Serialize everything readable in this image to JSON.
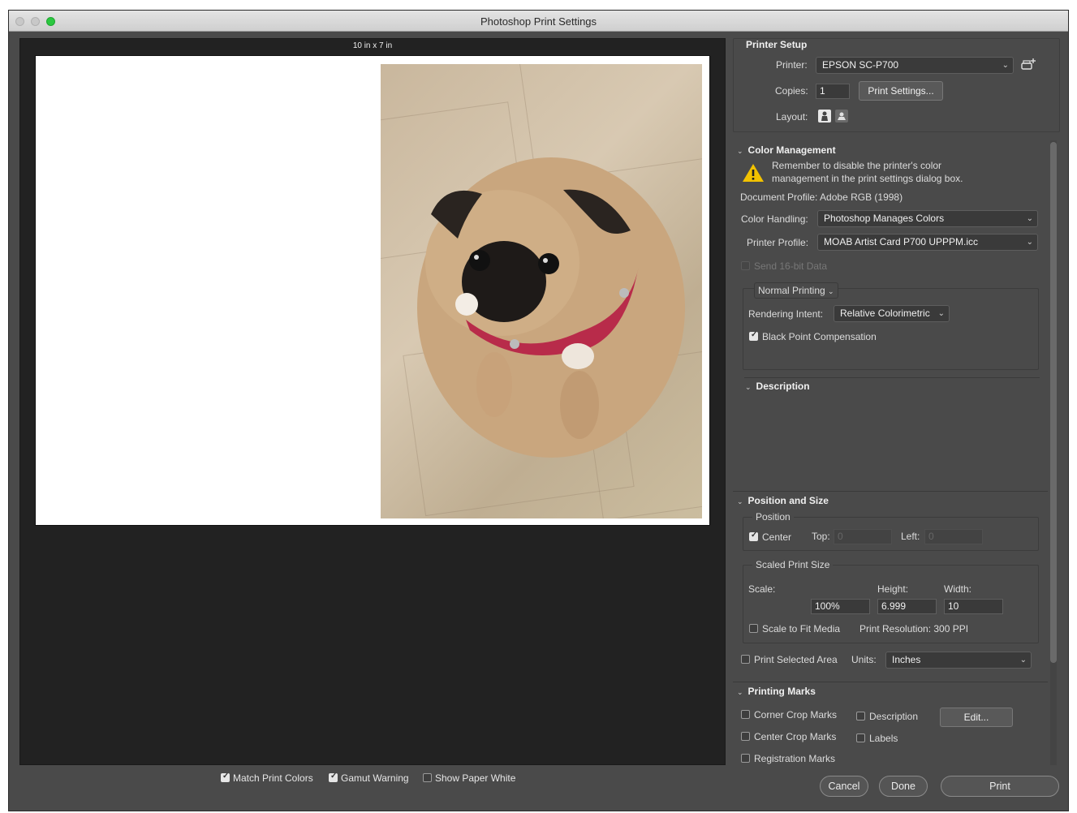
{
  "window": {
    "title": "Photoshop Print Settings"
  },
  "preview": {
    "paper_size_label": "10 in x 7 in"
  },
  "bottom_options": [
    {
      "label": "Match Print Colors",
      "checked": true
    },
    {
      "label": "Gamut Warning",
      "checked": true
    },
    {
      "label": "Show Paper White",
      "checked": false
    }
  ],
  "buttons": {
    "cancel": "Cancel",
    "done": "Done",
    "print": "Print"
  },
  "printer_setup": {
    "header": "Printer Setup",
    "printer_label": "Printer:",
    "printer_value": "EPSON SC-P700",
    "copies_label": "Copies:",
    "copies_value": "1",
    "print_settings_button": "Print Settings...",
    "layout_label": "Layout:"
  },
  "color_management": {
    "header": "Color Management",
    "warning_line1": "Remember to disable the printer's color",
    "warning_line2": "management in the print settings dialog box.",
    "document_profile": "Document Profile: Adobe RGB (1998)",
    "color_handling_label": "Color Handling:",
    "color_handling_value": "Photoshop Manages Colors",
    "printer_profile_label": "Printer Profile:",
    "printer_profile_value": "MOAB Artist Card P700 UPPPM.icc",
    "send_16bit_label": "Send 16-bit Data",
    "normal_printing": "Normal Printing",
    "rendering_intent_label": "Rendering Intent:",
    "rendering_intent_value": "Relative Colorimetric",
    "black_point_label": "Black Point Compensation",
    "black_point_checked": true
  },
  "description": {
    "header": "Description"
  },
  "position_and_size": {
    "header": "Position and Size",
    "position_label": "Position",
    "center_label": "Center",
    "center_checked": true,
    "top_label": "Top:",
    "top_value": "0",
    "left_label": "Left:",
    "left_value": "0",
    "scaled_print_size_label": "Scaled Print Size",
    "scale_label": "Scale:",
    "height_label": "Height:",
    "width_label": "Width:",
    "scale_value": "100%",
    "height_value": "6.999",
    "width_value": "10",
    "scale_to_fit_label": "Scale to Fit Media",
    "print_resolution": "Print Resolution: 300 PPI",
    "print_selected_area_label": "Print Selected Area",
    "units_label": "Units:",
    "units_value": "Inches"
  },
  "printing_marks": {
    "header": "Printing Marks",
    "corner_crop_marks": "Corner Crop Marks",
    "description": "Description",
    "edit_button": "Edit...",
    "center_crop_marks": "Center Crop Marks",
    "labels": "Labels",
    "registration_marks": "Registration Marks"
  }
}
